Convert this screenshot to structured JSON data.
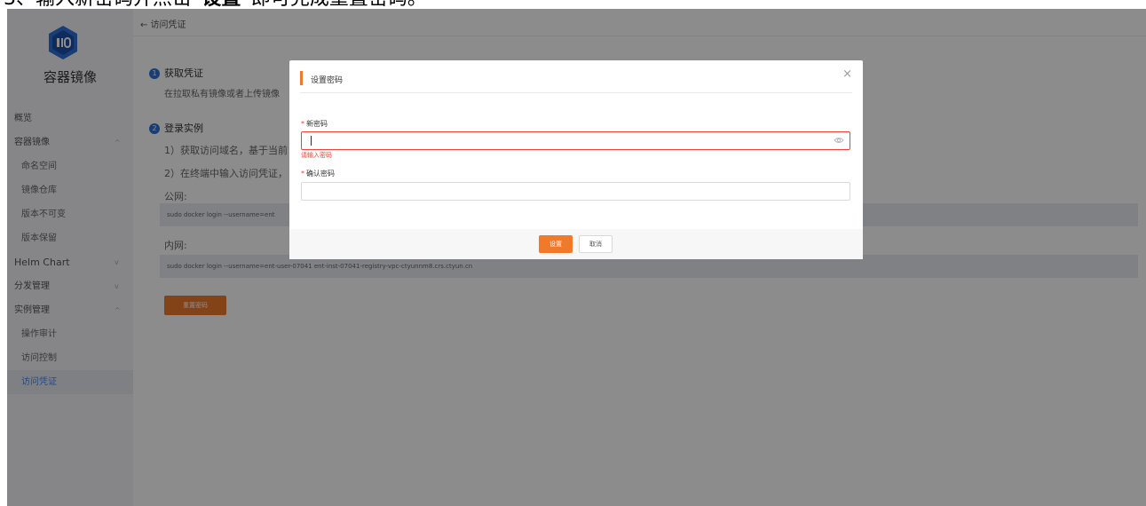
{
  "caption": {
    "prefix": "3、输入新密码并点击“",
    "bold": "设置",
    "suffix": "”即可完成重置密码。"
  },
  "sidebar": {
    "brand": "容器镜像",
    "items": [
      {
        "label": "概览",
        "sub": false,
        "chevron": ""
      },
      {
        "label": "容器镜像",
        "sub": false,
        "chevron": "^"
      },
      {
        "label": "命名空间",
        "sub": true,
        "chevron": ""
      },
      {
        "label": "镜像仓库",
        "sub": true,
        "chevron": ""
      },
      {
        "label": "版本不可变",
        "sub": true,
        "chevron": ""
      },
      {
        "label": "版本保留",
        "sub": true,
        "chevron": ""
      },
      {
        "label": "Helm Chart",
        "sub": false,
        "chevron": "v"
      },
      {
        "label": "分发管理",
        "sub": false,
        "chevron": "v"
      },
      {
        "label": "实例管理",
        "sub": false,
        "chevron": "^"
      },
      {
        "label": "操作审计",
        "sub": true,
        "chevron": ""
      },
      {
        "label": "访问控制",
        "sub": true,
        "chevron": ""
      },
      {
        "label": "访问凭证",
        "sub": true,
        "chevron": "",
        "active": true
      }
    ]
  },
  "topbar": {
    "back_label": "← 访问凭证"
  },
  "content": {
    "step1_num": "1",
    "step1_title": "获取凭证",
    "step1_desc": "在拉取私有镜像或者上传镜像",
    "step2_num": "2",
    "step2_title": "登录实例",
    "step2_line1": "1）获取访问域名，基于当前",
    "step2_line2": "2）在终端中输入访问凭证，",
    "public_label": "公网:",
    "public_cmd": "sudo docker login --username=ent",
    "private_label": "内网:",
    "private_cmd": "sudo docker login --username=ent-user-07041 ent-inst-07041-registry-vpc-ctyunnm8.crs.ctyun.cn",
    "reset_button": "重置密码"
  },
  "modal": {
    "title": "设置密码",
    "close": "×",
    "new_password_label": "新密码",
    "new_password_value": "",
    "new_password_error": "请输入密码",
    "confirm_password_label": "确认密码",
    "confirm_password_value": "",
    "required_mark": "*",
    "ok_button": "设置",
    "cancel_button": "取消"
  },
  "colors": {
    "accent": "#f07a2a",
    "error": "#f04134",
    "step": "#2f6fd6",
    "active_nav": "#4a86e8"
  }
}
